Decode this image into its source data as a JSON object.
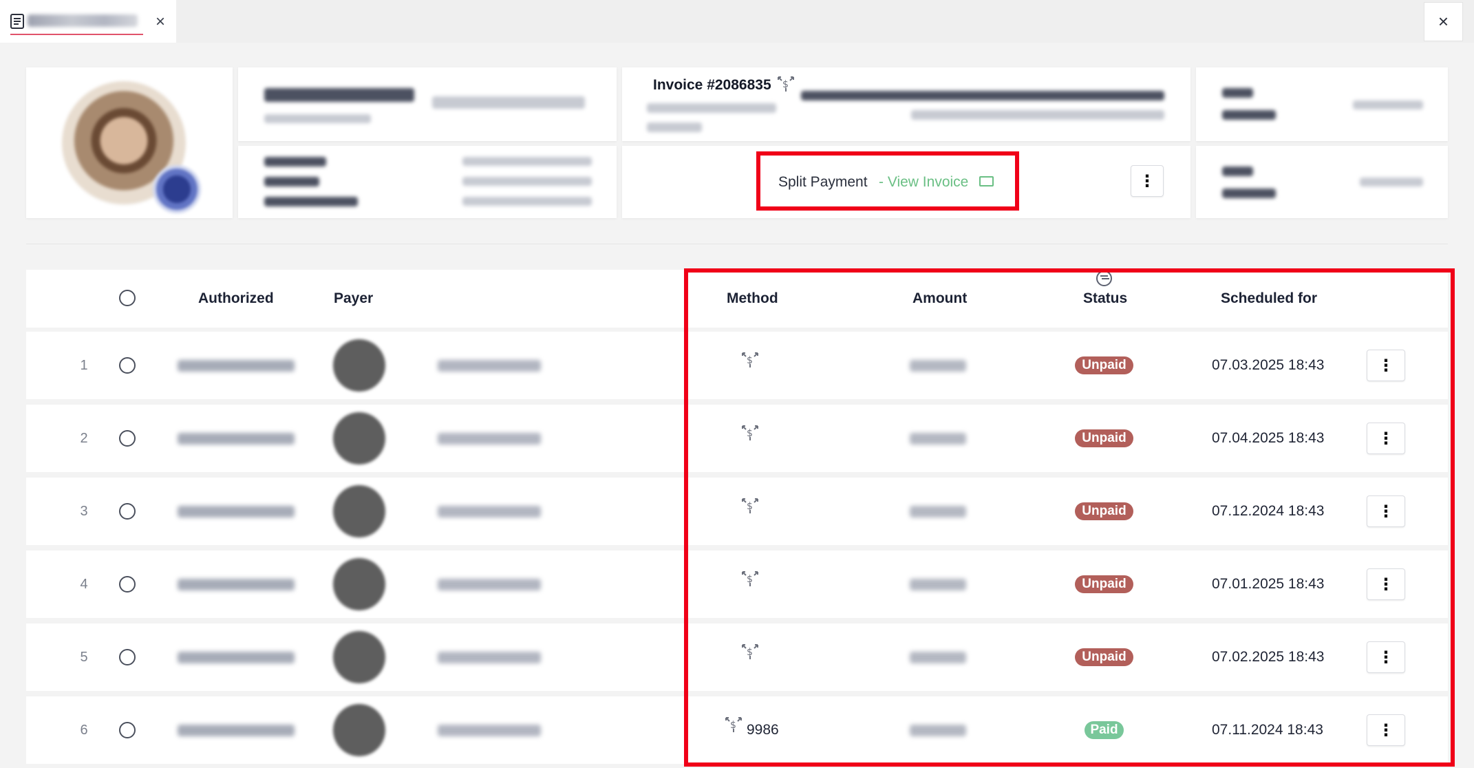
{
  "tab": {
    "close_label": "×"
  },
  "window": {
    "close_label": "×"
  },
  "invoice": {
    "title": "Invoice #2086835",
    "split_payment_label": "Split Payment",
    "view_invoice_label": "- View Invoice",
    "more_label": "⋮"
  },
  "table": {
    "headers": {
      "authorized": "Authorized",
      "payer": "Payer",
      "method": "Method",
      "amount": "Amount",
      "status": "Status",
      "scheduled_for": "Scheduled for"
    },
    "rows": [
      {
        "num": "1",
        "method": "",
        "status": "Unpaid",
        "scheduled": "07.03.2025 18:43",
        "more": "⋮"
      },
      {
        "num": "2",
        "method": "",
        "status": "Unpaid",
        "scheduled": "07.04.2025 18:43",
        "more": "⋮"
      },
      {
        "num": "3",
        "method": "",
        "status": "Unpaid",
        "scheduled": "07.12.2024 18:43",
        "more": "⋮"
      },
      {
        "num": "4",
        "method": "",
        "status": "Unpaid",
        "scheduled": "07.01.2025 18:43",
        "more": "⋮"
      },
      {
        "num": "5",
        "method": "",
        "status": "Unpaid",
        "scheduled": "07.02.2025 18:43",
        "more": "⋮"
      },
      {
        "num": "6",
        "method": "9986",
        "status": "Paid",
        "scheduled": "07.11.2024 18:43",
        "more": "⋮"
      }
    ]
  },
  "colors": {
    "accent_green": "#6abf84",
    "unpaid_badge": "#b25f5a",
    "paid_badge": "#79c79a",
    "highlight_red": "#f00018"
  },
  "icons": {
    "tab_icon": "document-icon",
    "method_icon": "split-payment-icon",
    "card_icon": "credit-card-icon",
    "filter_icon": "filter-icon"
  }
}
